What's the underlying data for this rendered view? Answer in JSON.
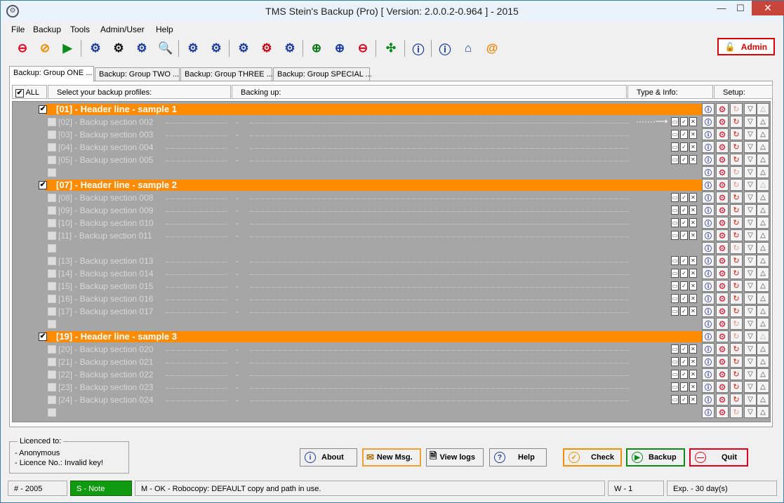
{
  "window": {
    "title": "TMS Stein's Backup (Pro) [ Version: 2.0.0.2-0.964 ] - 2015",
    "minimize_glyph": "—",
    "maximize_glyph": "☐",
    "close_glyph": "✕"
  },
  "menu": [
    "File",
    "Backup",
    "Tools",
    "Admin/User",
    "Help"
  ],
  "toolbar": {
    "admin_label": "Admin",
    "icons": [
      "stop-icon",
      "check-icon",
      "play-icon",
      "gear-icon",
      "gear-arrow-icon",
      "gear-list-icon",
      "search-doc-icon",
      "gear-page-icon",
      "gear-lines-icon",
      "gear-lock-icon",
      "gear-lock-red-icon",
      "gear-lock-open-icon",
      "zoom-icon",
      "zoom-in-icon",
      "zoom-out-icon",
      "collapse-icon",
      "help-icon",
      "info-icon",
      "home-icon",
      "at-icon"
    ]
  },
  "tabs": [
    {
      "label": "Backup: Group ONE ...",
      "active": true
    },
    {
      "label": "Backup: Group TWO ..."
    },
    {
      "label": "Backup: Group THREE ..."
    },
    {
      "label": "Backup: Group SPECIAL ..."
    }
  ],
  "columns": {
    "all": "ALL",
    "profiles": "Select your backup profiles:",
    "backing_up": "Backing up:",
    "type_info": "Type & Info:",
    "setup": "Setup:"
  },
  "rows": [
    {
      "kind": "header",
      "label": "[01] - Header line - sample 1"
    },
    {
      "kind": "item",
      "label": "[02] - Backup section 002",
      "arrow": true
    },
    {
      "kind": "item",
      "label": "[03] - Backup section 003"
    },
    {
      "kind": "item",
      "label": "[04] - Backup section 004"
    },
    {
      "kind": "item",
      "label": "[05] - Backup section 005"
    },
    {
      "kind": "empty"
    },
    {
      "kind": "header",
      "label": "[07] - Header line - sample 2"
    },
    {
      "kind": "item",
      "label": "[08] - Backup section 008"
    },
    {
      "kind": "item",
      "label": "[09] - Backup section 009"
    },
    {
      "kind": "item",
      "label": "[10] - Backup section 010"
    },
    {
      "kind": "item",
      "label": "[11] - Backup section 011"
    },
    {
      "kind": "empty"
    },
    {
      "kind": "item",
      "label": "[13] - Backup section 013"
    },
    {
      "kind": "item",
      "label": "[14] - Backup section 014"
    },
    {
      "kind": "item",
      "label": "[15] - Backup section 015"
    },
    {
      "kind": "item",
      "label": "[16] - Backup section 016"
    },
    {
      "kind": "item",
      "label": "[17] - Backup section 017"
    },
    {
      "kind": "empty"
    },
    {
      "kind": "header",
      "label": "[19] - Header line  - sample 3"
    },
    {
      "kind": "item",
      "label": "[20] - Backup section 020"
    },
    {
      "kind": "item",
      "label": "[21] - Backup section 021"
    },
    {
      "kind": "item",
      "label": "[22] - Backup section 022"
    },
    {
      "kind": "item",
      "label": "[23] - Backup section 023"
    },
    {
      "kind": "item",
      "label": "[24] - Backup section 024"
    },
    {
      "kind": "empty"
    }
  ],
  "row_text": {
    "dash": "-",
    "arrow": "·······⟶"
  },
  "licence": {
    "legend": "Licenced to:",
    "user": "- Anonymous",
    "number": "- Licence No.: Invalid key!"
  },
  "buttons": {
    "about": "About",
    "new_msg": "New Msg.",
    "view_logs": "View logs",
    "help": "Help",
    "check": "Check",
    "backup": "Backup",
    "quit": "Quit"
  },
  "status": {
    "count": "# - 2005",
    "note": "S - Note",
    "message": "M - OK - Robocopy: DEFAULT copy and path in use.",
    "w": "W - 1",
    "expiry": "Exp. - 30 day(s)"
  },
  "colors": {
    "header_orange": "#ff8c00",
    "grid_gray": "#a6a6a6",
    "note_green": "#109a10"
  }
}
